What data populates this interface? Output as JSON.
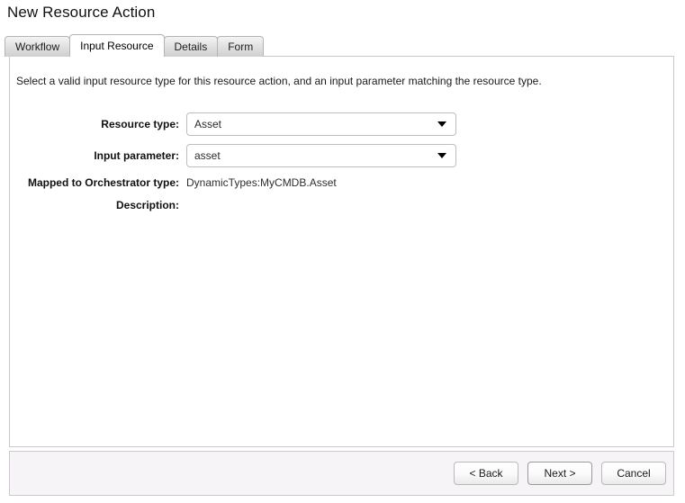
{
  "window": {
    "title": "New Resource Action"
  },
  "tabs": [
    {
      "label": "Workflow",
      "active": false
    },
    {
      "label": "Input Resource",
      "active": true
    },
    {
      "label": "Details",
      "active": false
    },
    {
      "label": "Form",
      "active": false
    }
  ],
  "content": {
    "instruction": "Select a valid input resource type for this resource action, and an input parameter matching the resource type.",
    "fields": [
      {
        "label": "Resource type:",
        "type": "select",
        "value": "Asset"
      },
      {
        "label": "Input parameter:",
        "type": "select",
        "value": "asset"
      },
      {
        "label": "Mapped to Orchestrator type:",
        "type": "static",
        "value": "DynamicTypes:MyCMDB.Asset"
      },
      {
        "label": "Description:",
        "type": "static",
        "value": ""
      }
    ]
  },
  "footer": {
    "buttons": [
      {
        "label": "< Back",
        "default": false
      },
      {
        "label": "Next >",
        "default": true
      },
      {
        "label": "Cancel",
        "default": false
      }
    ]
  },
  "icons": {
    "dropdown": "chevron-down-icon"
  },
  "colors": {
    "panel_background": "#ffffff",
    "panel_border": "#c9c9c9",
    "footer_background": "#f7f4f7",
    "tab_inactive_top": "#f4f4f4",
    "tab_inactive_bottom": "#cfcfcf",
    "text": "#1a1a1a"
  }
}
